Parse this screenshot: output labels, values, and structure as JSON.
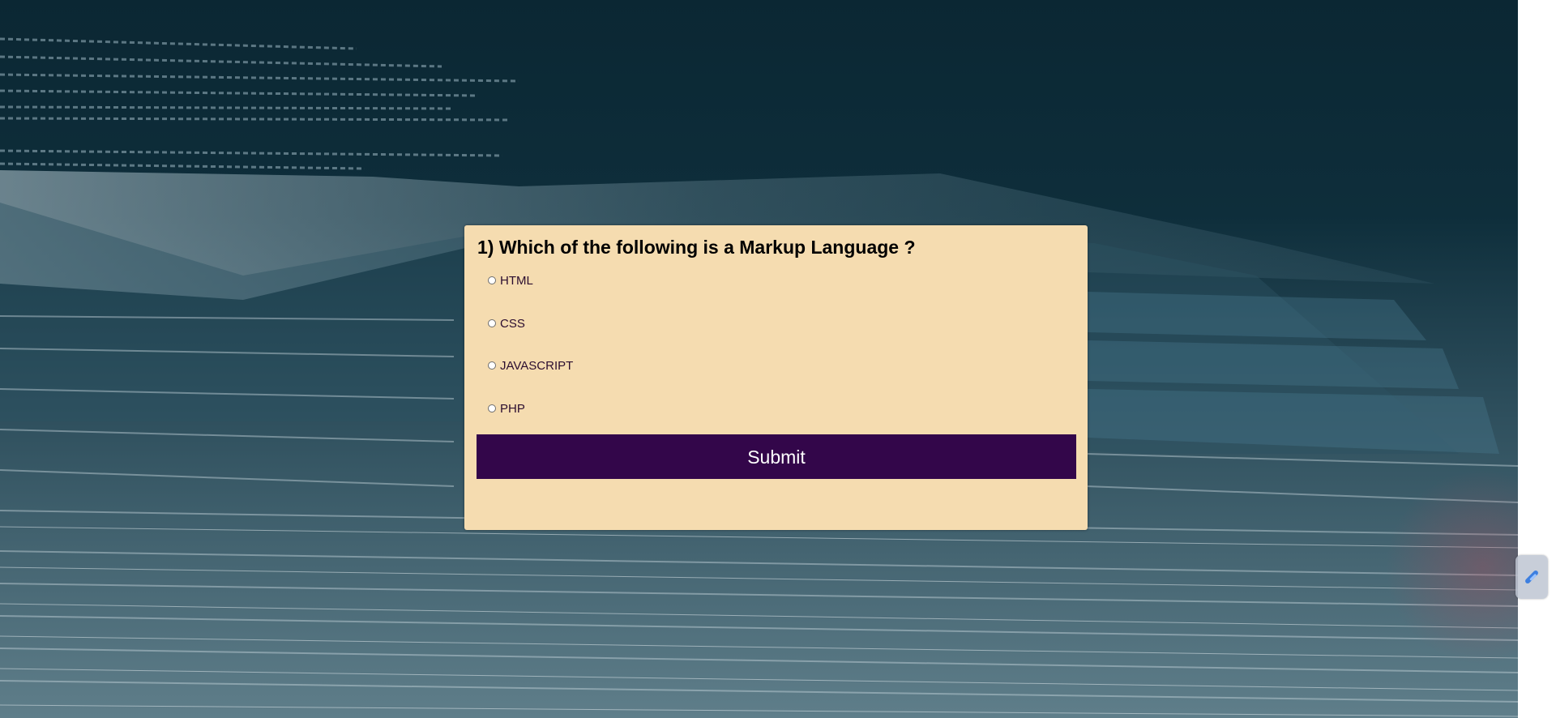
{
  "quiz": {
    "question": "1) Which of the following is a Markup Language ?",
    "options": [
      {
        "label": "HTML"
      },
      {
        "label": "CSS"
      },
      {
        "label": "JAVASCRIPT"
      },
      {
        "label": "PHP"
      }
    ],
    "submit_label": "Submit"
  },
  "colors": {
    "card_background": "#f5dcb0",
    "submit_background": "#33064a",
    "page_background": "#0b2733"
  },
  "icons": {
    "floating_widget": "pen-icon"
  }
}
